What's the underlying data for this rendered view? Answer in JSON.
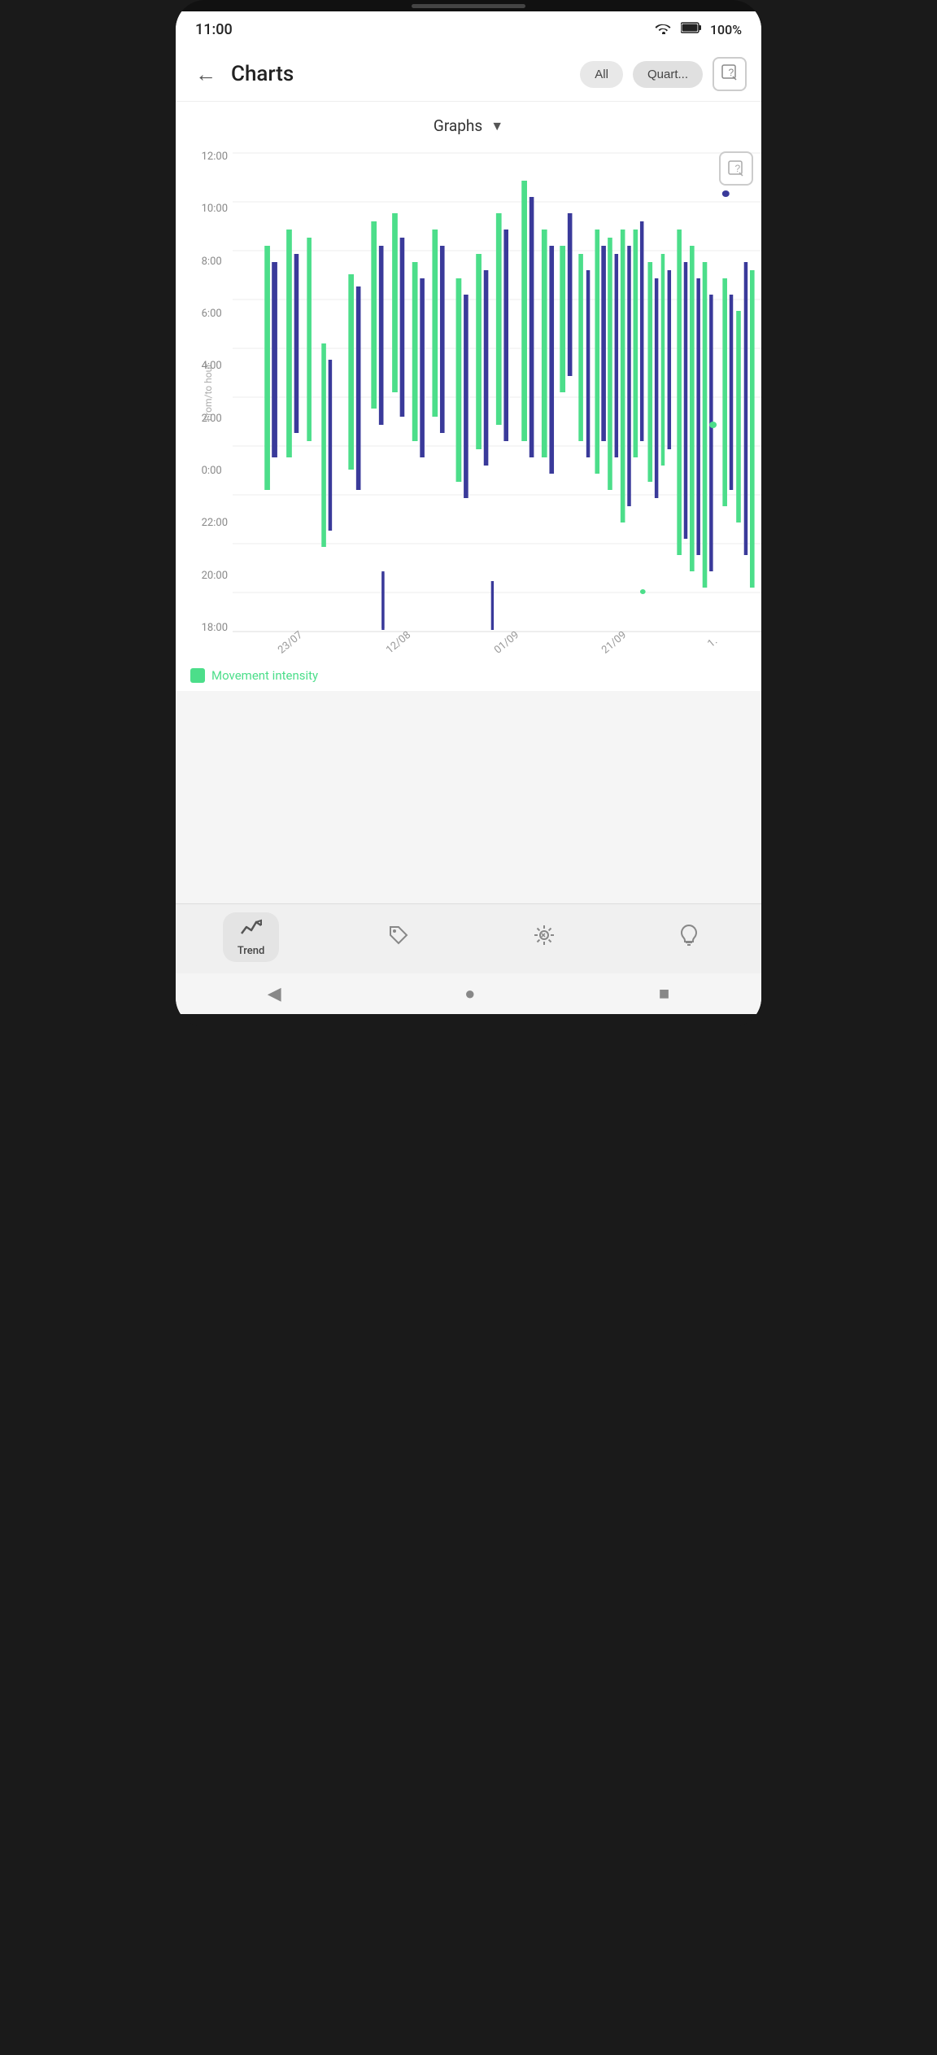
{
  "statusBar": {
    "time": "11:00",
    "wifi": "wifi",
    "battery": "100%"
  },
  "header": {
    "backLabel": "←",
    "title": "Charts",
    "filterAll": "All",
    "filterQuart": "Quart...",
    "helpIcon": "?"
  },
  "dropdown": {
    "label": "Graphs",
    "arrowIcon": "▼"
  },
  "chart": {
    "helpIcon": "?",
    "yAxisTitle": "From/to hour",
    "yLabels": [
      "12:00",
      "10:00",
      "8:00",
      "6:00",
      "4:00",
      "2:00",
      "0:00",
      "22:00",
      "20:00",
      "18:00"
    ],
    "xLabels": [
      "23/07",
      "12/08",
      "01/09",
      "21/09",
      "1."
    ],
    "legendColor": "#4cde8a",
    "legendLabel": "Movement intensity"
  },
  "bottomNav": {
    "items": [
      {
        "id": "trend",
        "label": "Trend",
        "icon": "📈",
        "active": true
      },
      {
        "id": "tag",
        "label": "",
        "icon": "🏷",
        "active": false
      },
      {
        "id": "activity",
        "label": "",
        "icon": "☀",
        "active": false
      },
      {
        "id": "insight",
        "label": "",
        "icon": "💡",
        "active": false
      }
    ]
  },
  "sysNav": {
    "back": "◀",
    "home": "●",
    "recents": "■"
  }
}
